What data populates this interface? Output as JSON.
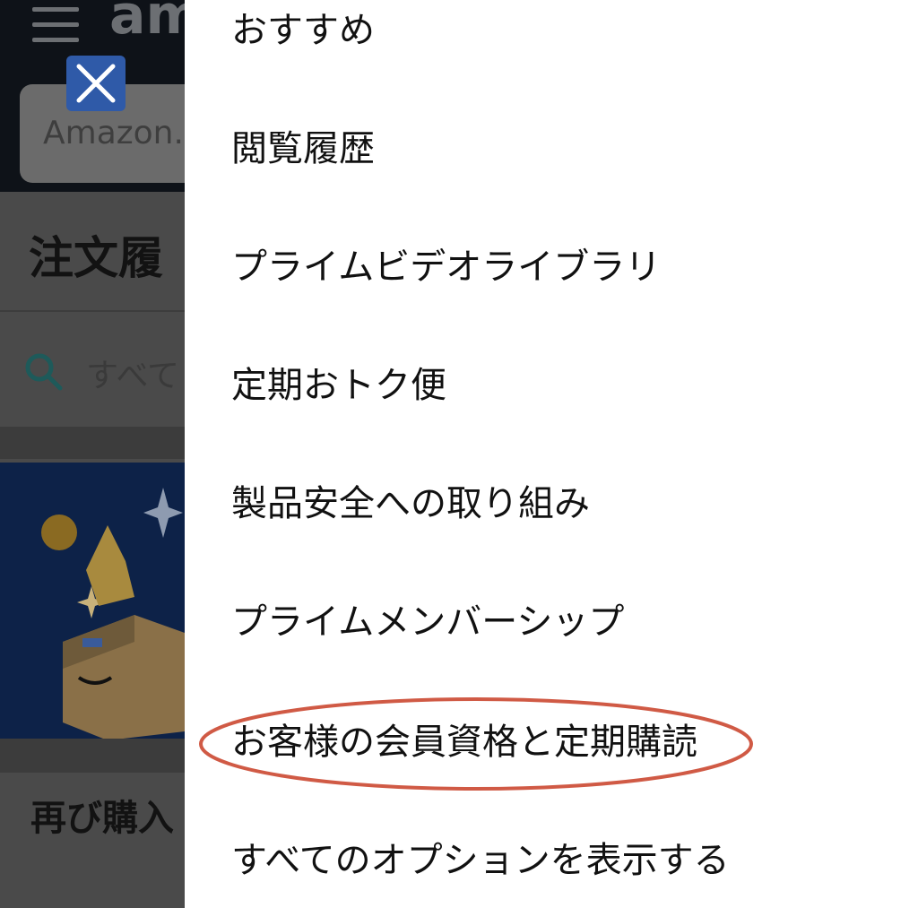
{
  "background_app": {
    "logo_text": "am",
    "search_placeholder": "Amazon.",
    "page_title": "注文履",
    "filter_placeholder": "すべて",
    "rebuy_heading": "再び購入"
  },
  "drawer": {
    "items": [
      {
        "label": "おすすめ"
      },
      {
        "label": "閲覧履歴"
      },
      {
        "label": "プライムビデオライブラリ"
      },
      {
        "label": "定期おトク便"
      },
      {
        "label": "製品安全への取り組み"
      },
      {
        "label": "プライムメンバーシップ"
      },
      {
        "label": "お客様の会員資格と定期購読",
        "highlighted": true
      },
      {
        "label": "すべてのオプションを表示する"
      }
    ]
  },
  "colors": {
    "highlight_oval": "#d05a45",
    "close_button": "#2f5aa8",
    "overlay": "#4a4a4a"
  },
  "icons": {
    "close": "close-icon",
    "menu": "hamburger-icon",
    "search": "search-icon"
  }
}
